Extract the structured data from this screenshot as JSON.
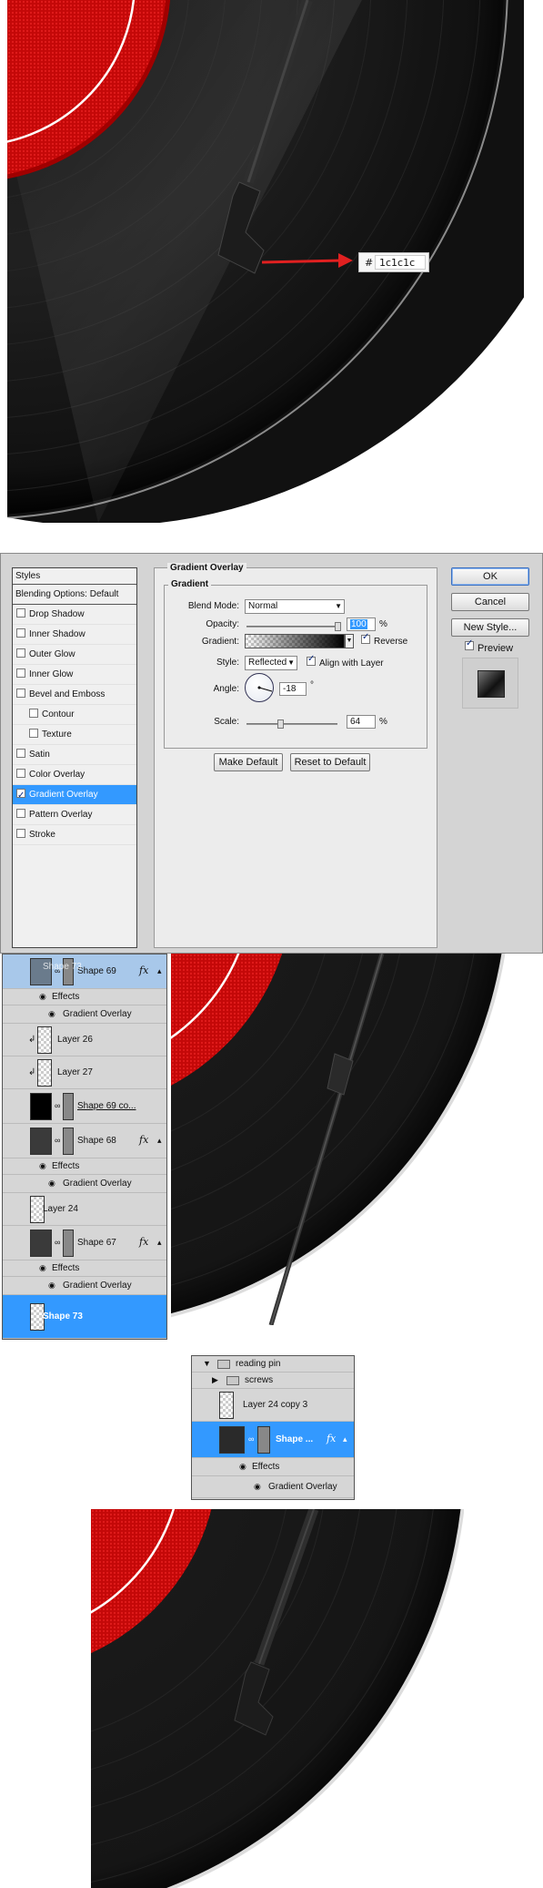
{
  "color_label": {
    "hash": "#",
    "value": "1c1c1c"
  },
  "dialog": {
    "styles_header": "Styles",
    "blending_options": "Blending Options: Default",
    "style_items": [
      {
        "label": "Drop Shadow",
        "checked": false,
        "sub": false
      },
      {
        "label": "Inner Shadow",
        "checked": false,
        "sub": false
      },
      {
        "label": "Outer Glow",
        "checked": false,
        "sub": false
      },
      {
        "label": "Inner Glow",
        "checked": false,
        "sub": false
      },
      {
        "label": "Bevel and Emboss",
        "checked": false,
        "sub": false
      },
      {
        "label": "Contour",
        "checked": false,
        "sub": true
      },
      {
        "label": "Texture",
        "checked": false,
        "sub": true
      },
      {
        "label": "Satin",
        "checked": false,
        "sub": false
      },
      {
        "label": "Color Overlay",
        "checked": false,
        "sub": false
      },
      {
        "label": "Gradient Overlay",
        "checked": true,
        "sub": false,
        "selected": true
      },
      {
        "label": "Pattern Overlay",
        "checked": false,
        "sub": false
      },
      {
        "label": "Stroke",
        "checked": false,
        "sub": false
      }
    ],
    "section_title": "Gradient Overlay",
    "group_title": "Gradient",
    "blend_mode_label": "Blend Mode:",
    "blend_mode_value": "Normal",
    "opacity_label": "Opacity:",
    "opacity_value": "100",
    "opacity_unit": "%",
    "opacity_level": 1.0,
    "gradient_label": "Gradient:",
    "reverse_label": "Reverse",
    "style_label": "Style:",
    "style_value": "Reflected",
    "align_label": "Align with Layer",
    "angle_label": "Angle:",
    "angle_value": "-18",
    "angle_unit": "°",
    "scale_label": "Scale:",
    "scale_value": "64",
    "scale_unit": "%",
    "scale_level": 0.64,
    "make_default": "Make Default",
    "reset_default": "Reset to Default",
    "ok": "OK",
    "cancel": "Cancel",
    "new_style": "New Style...",
    "preview_label": "Preview"
  },
  "layers1": {
    "rows": [
      {
        "name": "Shape 69",
        "ghost": "Shape 73",
        "fx": "fx"
      },
      {
        "name": "Effects"
      },
      {
        "name": "Gradient Overlay"
      },
      {
        "name": "Layer 26"
      },
      {
        "name": "Layer 27"
      },
      {
        "name": "Shape 69 co..."
      },
      {
        "name": "Shape 68",
        "fx": "fx"
      },
      {
        "name": "Effects"
      },
      {
        "name": "Gradient Overlay"
      },
      {
        "name": "Layer 24"
      },
      {
        "name": "Shape 67",
        "fx": "fx"
      },
      {
        "name": "Effects"
      },
      {
        "name": "Gradient Overlay"
      },
      {
        "name": "Shape 73"
      }
    ]
  },
  "layers2": {
    "rows": [
      {
        "name": "reading pin"
      },
      {
        "name": "screws"
      },
      {
        "name": "Layer 24 copy 3"
      },
      {
        "name": "Shape ...",
        "fx": "fx"
      },
      {
        "name": "Effects"
      },
      {
        "name": "Gradient Overlay"
      }
    ]
  }
}
